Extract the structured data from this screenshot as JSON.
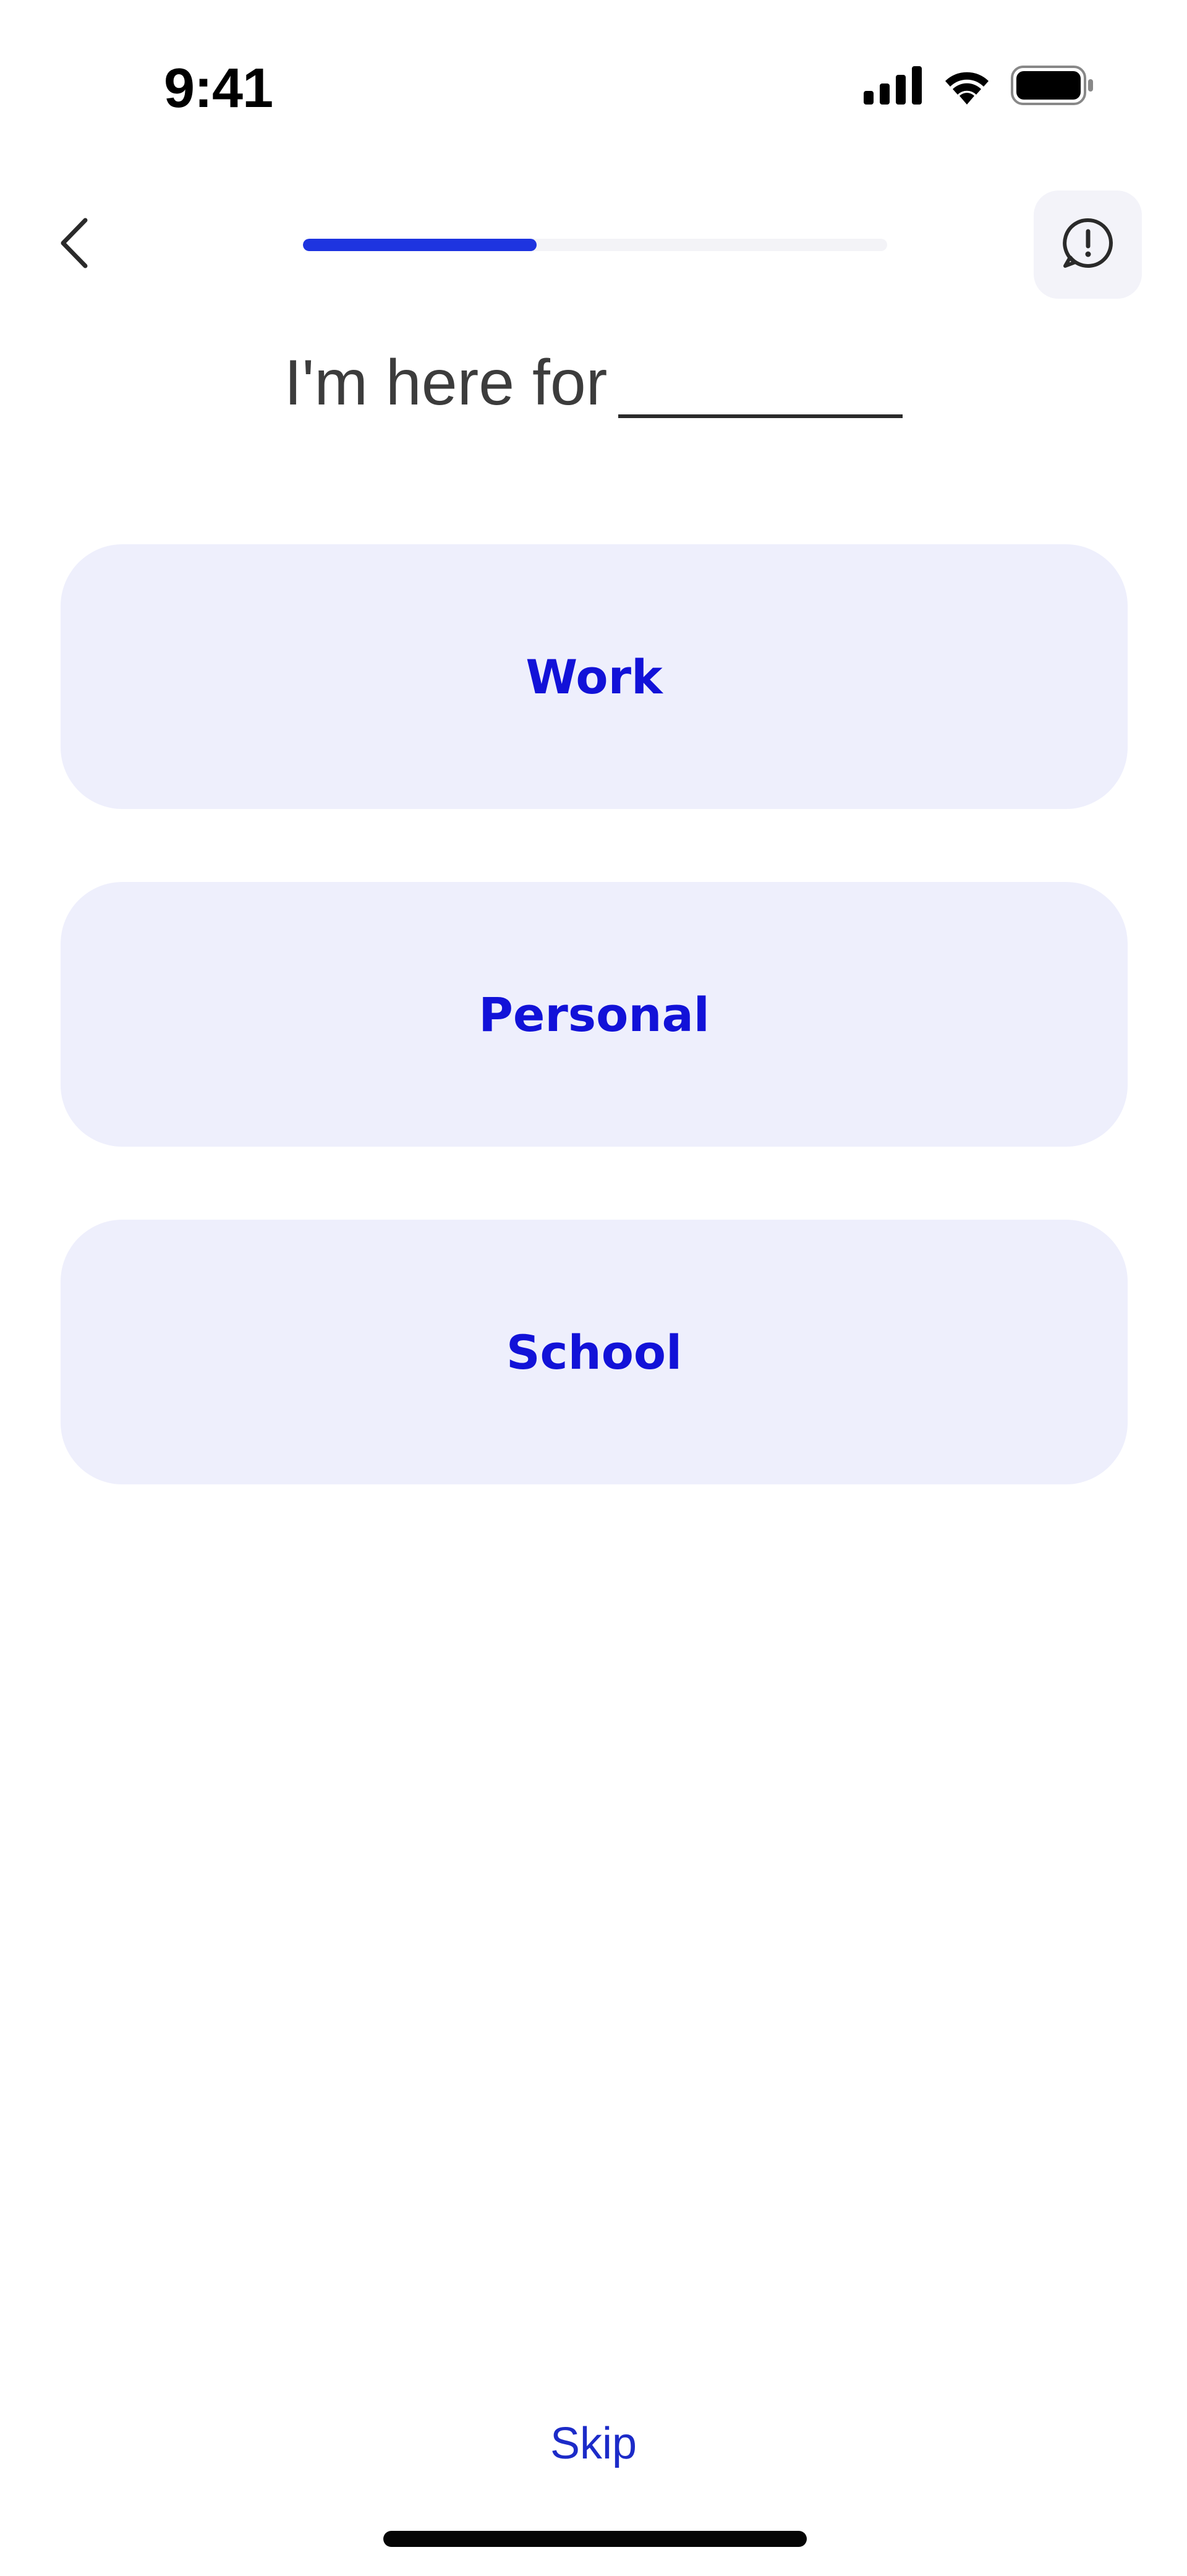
{
  "status_bar": {
    "time": "9:41",
    "icons": [
      "cellular-signal-icon",
      "wifi-icon",
      "battery-icon"
    ]
  },
  "nav": {
    "back_icon": "chevron-left-icon",
    "progress_percent": 40,
    "report_icon": "alert-chat-icon"
  },
  "question": {
    "text": "I'm here for"
  },
  "options": [
    {
      "label": "Work"
    },
    {
      "label": "Personal"
    },
    {
      "label": "School"
    }
  ],
  "footer": {
    "skip_label": "Skip"
  },
  "colors": {
    "accent": "#1e34e0",
    "option_bg": "#eeeffc",
    "option_text": "#1212d8",
    "progress_track": "#f3f3f7"
  }
}
